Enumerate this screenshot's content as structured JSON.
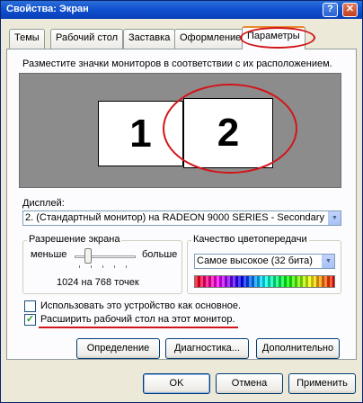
{
  "window": {
    "title": "Свойства: Экран",
    "help_glyph": "?",
    "close_glyph": "✕"
  },
  "tabs": [
    {
      "label": "Темы"
    },
    {
      "label": "Рабочий стол"
    },
    {
      "label": "Заставка"
    },
    {
      "label": "Оформление"
    },
    {
      "label": "Параметры",
      "active": true
    }
  ],
  "instruction": "Разместите значки мониторов в соответствии с их расположением.",
  "monitors": [
    {
      "number": "1"
    },
    {
      "number": "2",
      "selected": true
    }
  ],
  "display": {
    "label": "Дисплей:",
    "value": "2. (Стандартный монитор) на RADEON 9000 SERIES - Secondary"
  },
  "resolution": {
    "group_label": "Разрешение экрана",
    "less": "меньше",
    "more": "больше",
    "value_text": "1024 на 768 точек",
    "slider_position": 0.2
  },
  "color_quality": {
    "group_label": "Качество цветопередачи",
    "value": "Самое высокое (32 бита)"
  },
  "options": {
    "primary_label": "Использовать это устройство как основное.",
    "primary_checked": false,
    "extend_label": "Расширить рабочий стол на этот монитор.",
    "extend_checked": true,
    "check_glyph": "✓"
  },
  "panel_buttons": {
    "identify": "Определение",
    "troubleshoot": "Диагностика...",
    "advanced": "Дополнительно"
  },
  "dialog_buttons": {
    "ok": "OK",
    "cancel": "Отмена",
    "apply": "Применить"
  },
  "colors": {
    "accent_annotation": "#d2151a",
    "title_bar": "#0f4fcf",
    "dialog_bg": "#ece9d8"
  }
}
